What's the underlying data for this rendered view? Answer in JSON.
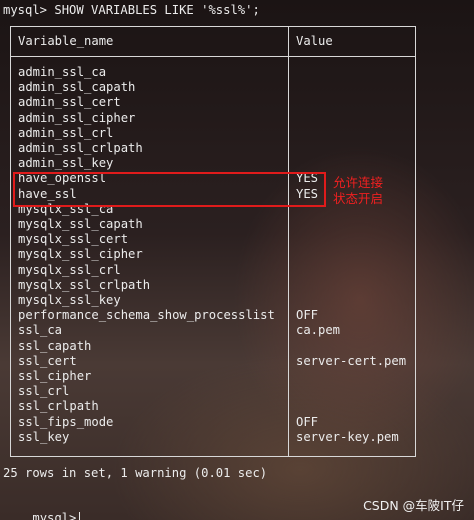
{
  "terminal": {
    "command_line": "mysql> SHOW VARIABLES LIKE '%ssl%';",
    "header": {
      "col1": "Variable_name",
      "col2": "Value"
    },
    "rows": [
      {
        "name": "admin_ssl_ca",
        "value": ""
      },
      {
        "name": "admin_ssl_capath",
        "value": ""
      },
      {
        "name": "admin_ssl_cert",
        "value": ""
      },
      {
        "name": "admin_ssl_cipher",
        "value": ""
      },
      {
        "name": "admin_ssl_crl",
        "value": ""
      },
      {
        "name": "admin_ssl_crlpath",
        "value": ""
      },
      {
        "name": "admin_ssl_key",
        "value": ""
      },
      {
        "name": "have_openssl",
        "value": "YES"
      },
      {
        "name": "have_ssl",
        "value": "YES"
      },
      {
        "name": "mysqlx_ssl_ca",
        "value": ""
      },
      {
        "name": "mysqlx_ssl_capath",
        "value": ""
      },
      {
        "name": "mysqlx_ssl_cert",
        "value": ""
      },
      {
        "name": "mysqlx_ssl_cipher",
        "value": ""
      },
      {
        "name": "mysqlx_ssl_crl",
        "value": ""
      },
      {
        "name": "mysqlx_ssl_crlpath",
        "value": ""
      },
      {
        "name": "mysqlx_ssl_key",
        "value": ""
      },
      {
        "name": "performance_schema_show_processlist",
        "value": "OFF"
      },
      {
        "name": "ssl_ca",
        "value": "ca.pem"
      },
      {
        "name": "ssl_capath",
        "value": ""
      },
      {
        "name": "ssl_cert",
        "value": "server-cert.pem"
      },
      {
        "name": "ssl_cipher",
        "value": ""
      },
      {
        "name": "ssl_crl",
        "value": ""
      },
      {
        "name": "ssl_crlpath",
        "value": ""
      },
      {
        "name": "ssl_fips_mode",
        "value": "OFF"
      },
      {
        "name": "ssl_key",
        "value": "server-key.pem"
      }
    ],
    "summary": "25 rows in set, 1 warning (0.01 sec)",
    "prompt": "mysql>"
  },
  "annotation": {
    "line1": "允许连接",
    "line2": "状态开启",
    "color": "#f02020"
  },
  "watermark": "CSDN @车陂IT仔"
}
